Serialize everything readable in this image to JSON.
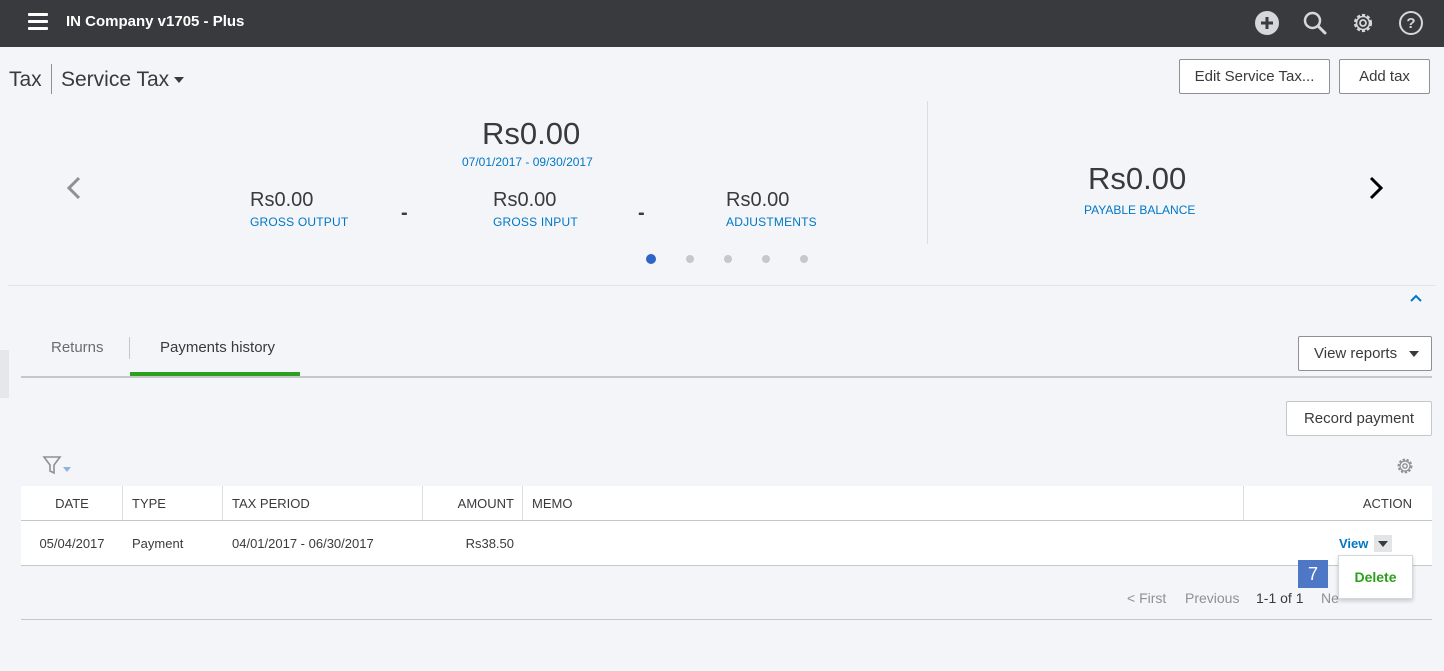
{
  "app": {
    "company_name": "IN Company v1705 - Plus"
  },
  "header": {
    "title": "Tax",
    "subtitle": "Service Tax",
    "edit_button": "Edit Service Tax...",
    "add_button": "Add tax"
  },
  "summary": {
    "total": "Rs0.00",
    "period": "07/01/2017 - 09/30/2017",
    "gross_output": {
      "amount": "Rs0.00",
      "label": "GROSS OUTPUT"
    },
    "gross_input": {
      "amount": "Rs0.00",
      "label": "GROSS INPUT"
    },
    "adjustments": {
      "amount": "Rs0.00",
      "label": "ADJUSTMENTS"
    },
    "minus": "-",
    "payable": {
      "amount": "Rs0.00",
      "label": "PAYABLE BALANCE"
    },
    "carousel_pages": 5,
    "carousel_active": 0
  },
  "tabs": [
    {
      "label": "Returns",
      "active": false
    },
    {
      "label": "Payments history",
      "active": true
    }
  ],
  "toolbar": {
    "view_reports": "View reports",
    "record_payment": "Record payment"
  },
  "table": {
    "columns": [
      "DATE",
      "TYPE",
      "TAX PERIOD",
      "AMOUNT",
      "MEMO",
      "ACTION"
    ],
    "rows": [
      {
        "date": "05/04/2017",
        "type": "Payment",
        "tax_period": "04/01/2017 - 06/30/2017",
        "amount": "Rs38.50",
        "memo": "",
        "action": "View"
      }
    ]
  },
  "pagination": {
    "first": "< First",
    "previous": "Previous",
    "range": "1-1 of 1",
    "next": "Ne"
  },
  "action_menu": {
    "delete": "Delete"
  },
  "badge": "7",
  "colors": {
    "topbar": "#393a3d",
    "link": "#0077c5",
    "accent_green": "#2ca01c",
    "badge": "#4e78c6"
  },
  "icons": [
    "hamburger-icon",
    "plus-circle-icon",
    "search-icon",
    "gear-icon",
    "help-icon",
    "chevron-left-icon",
    "chevron-right-icon",
    "chevron-up-icon",
    "filter-icon",
    "settings-gear-icon",
    "caret-down-icon"
  ]
}
